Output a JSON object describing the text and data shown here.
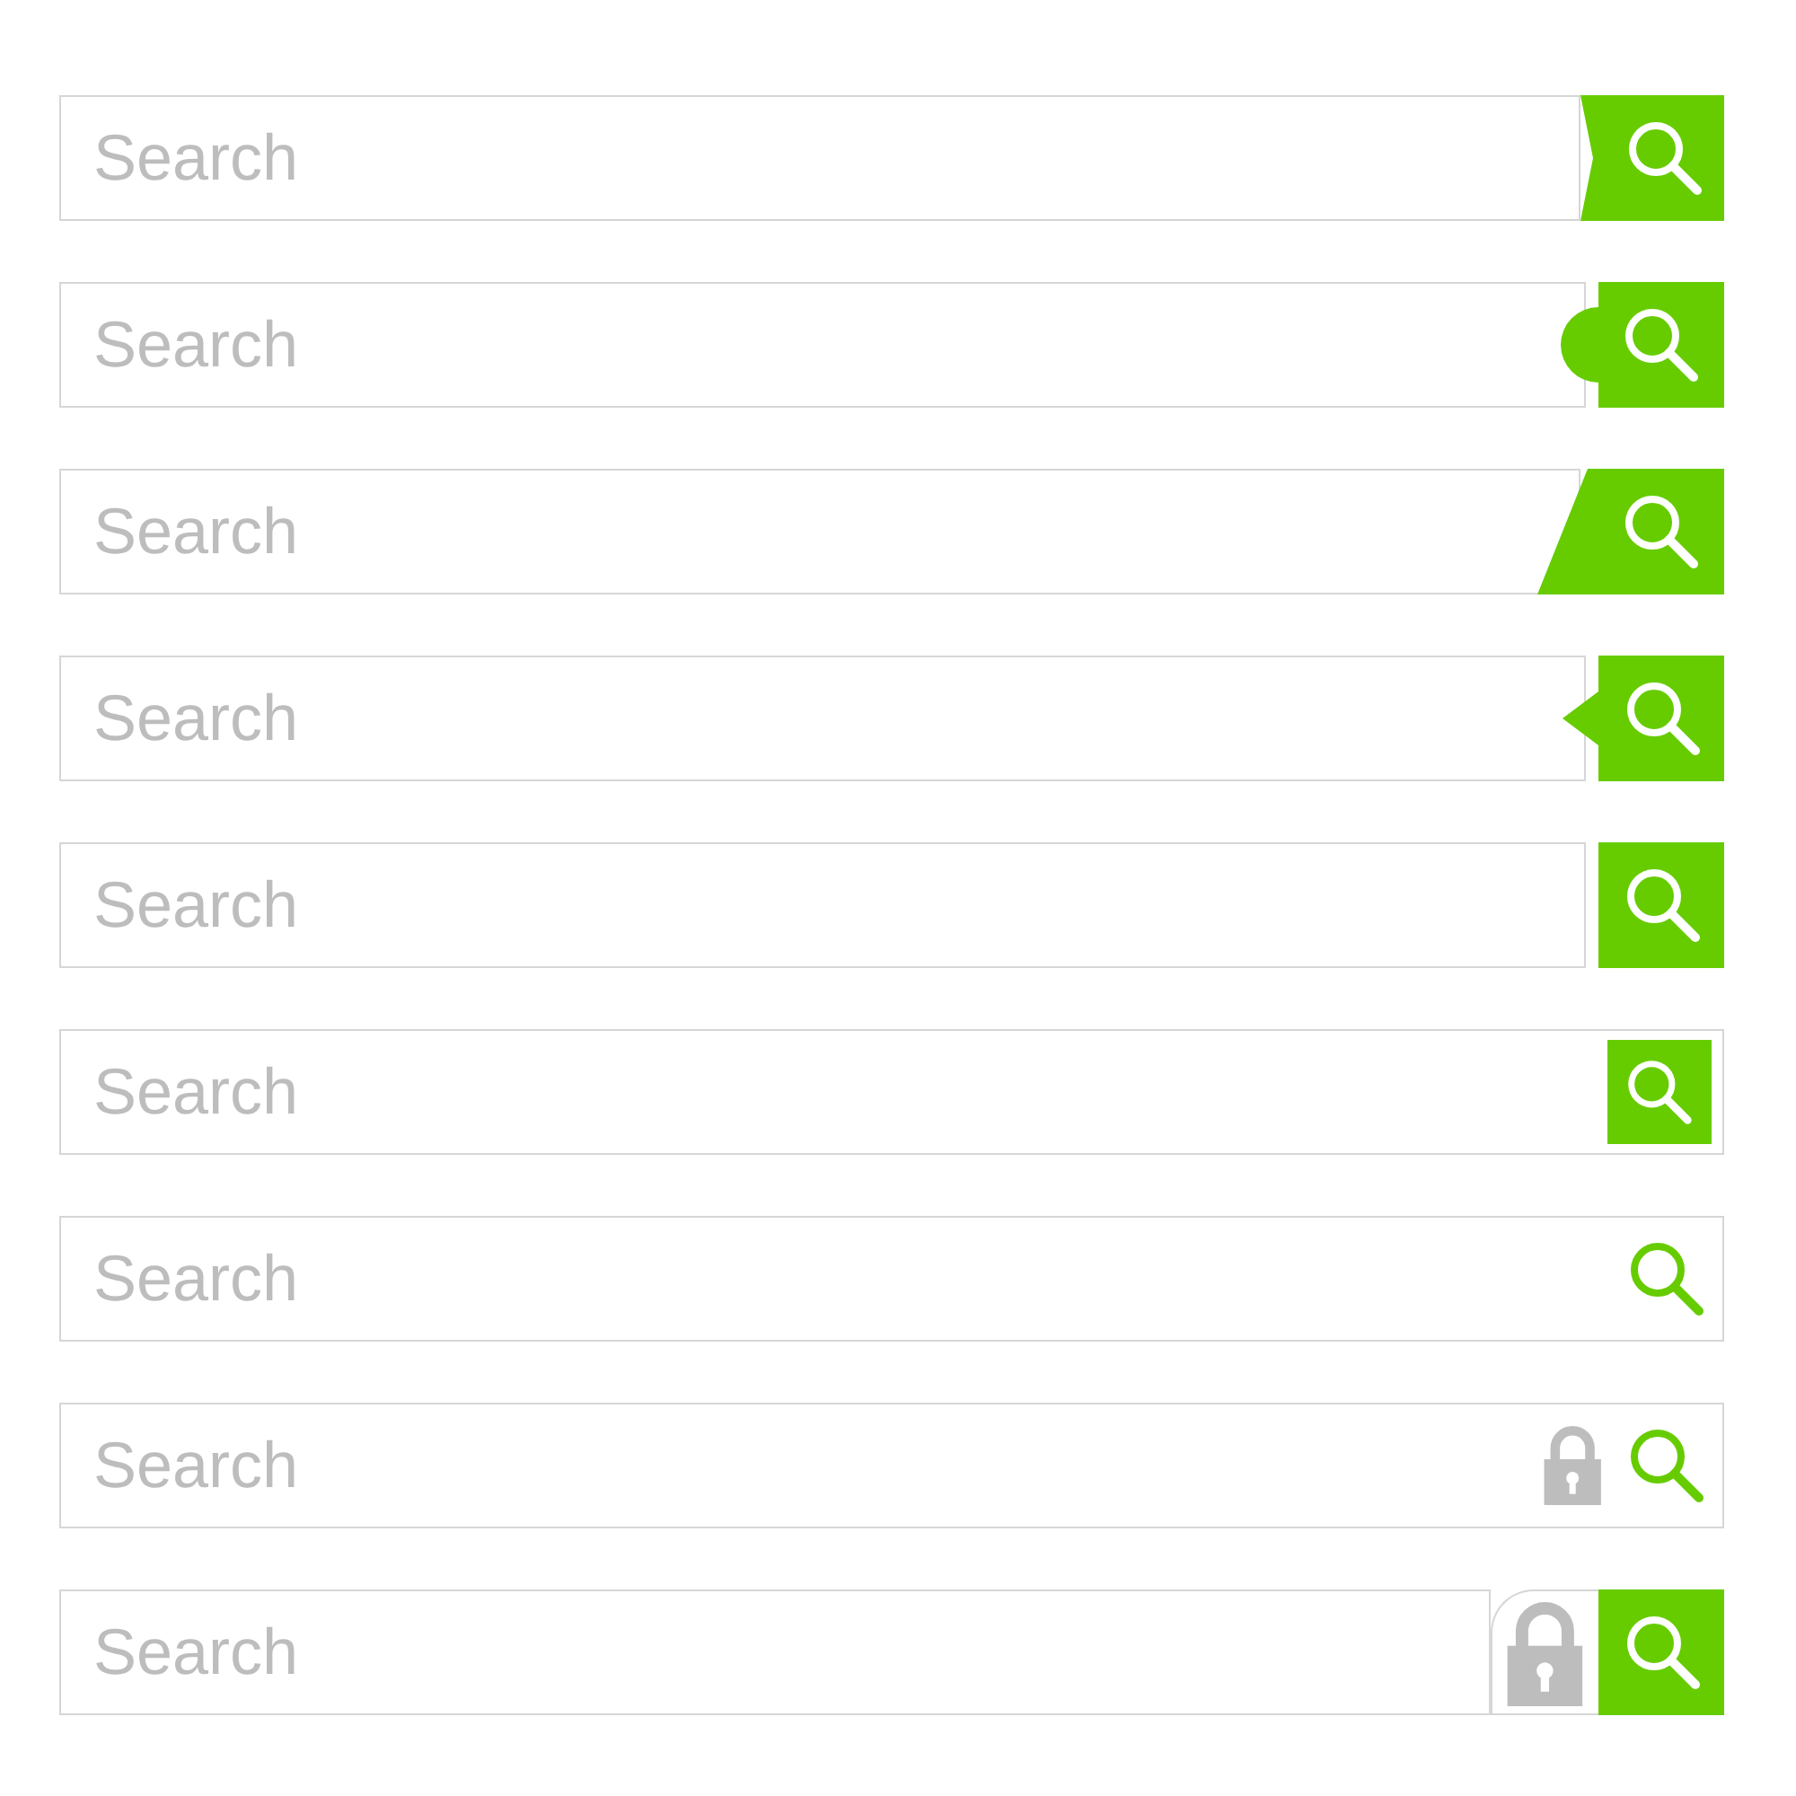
{
  "search_bars": [
    {
      "kind": "arrow",
      "placeholder": "Search"
    },
    {
      "kind": "round",
      "placeholder": "Search"
    },
    {
      "kind": "slant",
      "placeholder": "Search"
    },
    {
      "kind": "pointer",
      "placeholder": "Search"
    },
    {
      "kind": "square",
      "placeholder": "Search"
    },
    {
      "kind": "inset",
      "placeholder": "Search"
    },
    {
      "kind": "plain",
      "placeholder": "Search"
    },
    {
      "kind": "lock",
      "placeholder": "Search"
    },
    {
      "kind": "lock-tab",
      "placeholder": "Search"
    }
  ]
}
